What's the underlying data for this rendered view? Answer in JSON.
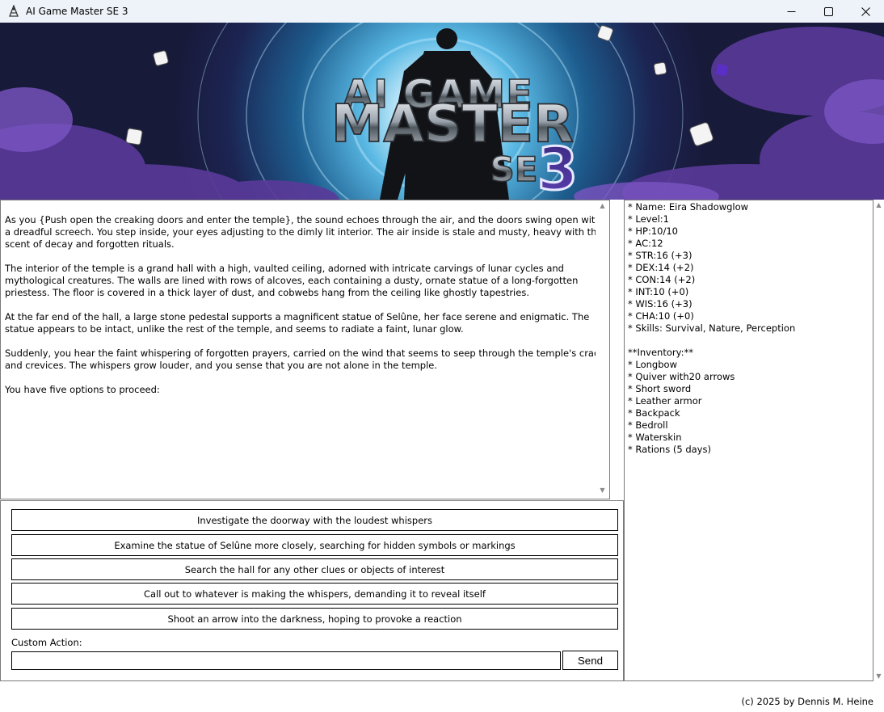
{
  "window": {
    "title": "AI Game Master SE 3",
    "minimize_icon": "minimize-icon",
    "maximize_icon": "maximize-icon",
    "close_icon": "close-icon"
  },
  "banner": {
    "line1": "AI GAME",
    "line2": "MASTER",
    "se": "SE",
    "num": "3"
  },
  "story": {
    "paragraphs": [
      "As you {Push open the creaking doors and enter the temple}, the sound echoes through the air, and the doors swing open with a dreadful screech. You step inside, your eyes adjusting to the dimly lit interior. The air inside is stale and musty, heavy with the scent of decay and forgotten rituals.",
      "The interior of the temple is a grand hall with a high, vaulted ceiling, adorned with intricate carvings of lunar cycles and mythological creatures. The walls are lined with rows of alcoves, each containing a dusty, ornate statue of a long-forgotten priestess. The floor is covered in a thick layer of dust, and cobwebs hang from the ceiling like ghostly tapestries.",
      "At the far end of the hall, a large stone pedestal supports a magnificent statue of Selûne, her face serene and enigmatic. The statue appears to be intact, unlike the rest of the temple, and seems to radiate a faint, lunar glow.",
      "Suddenly, you hear the faint whispering of forgotten prayers, carried on the wind that seems to seep through the temple's cracks and crevices. The whispers grow louder, and you sense that you are not alone in the temple.",
      "You have five options to proceed:"
    ]
  },
  "character": {
    "lines": [
      "* Name: Eira Shadowglow",
      "* Level:1",
      "* HP:10/10",
      "* AC:12",
      "* STR:16 (+3)",
      "* DEX:14 (+2)",
      "* CON:14 (+2)",
      "* INT:10 (+0)",
      "* WIS:16 (+3)",
      "* CHA:10 (+0)",
      "* Skills: Survival, Nature, Perception",
      "",
      "**Inventory:**",
      "* Longbow",
      "* Quiver with20 arrows",
      "* Short sword",
      "* Leather armor",
      "* Backpack",
      "* Bedroll",
      "* Waterskin",
      "* Rations (5 days)"
    ]
  },
  "options": [
    "Investigate the doorway with the loudest whispers",
    "Examine the statue of Selûne more closely, searching for hidden symbols or markings",
    "Search the hall for any other clues or objects of interest",
    "Call out to whatever is making the whispers, demanding it to reveal itself",
    "Shoot an arrow into the darkness, hoping to provoke a reaction"
  ],
  "custom": {
    "label": "Custom Action:",
    "value": "",
    "send_label": "Send"
  },
  "footer": "(c) 2025 by Dennis M. Heine"
}
